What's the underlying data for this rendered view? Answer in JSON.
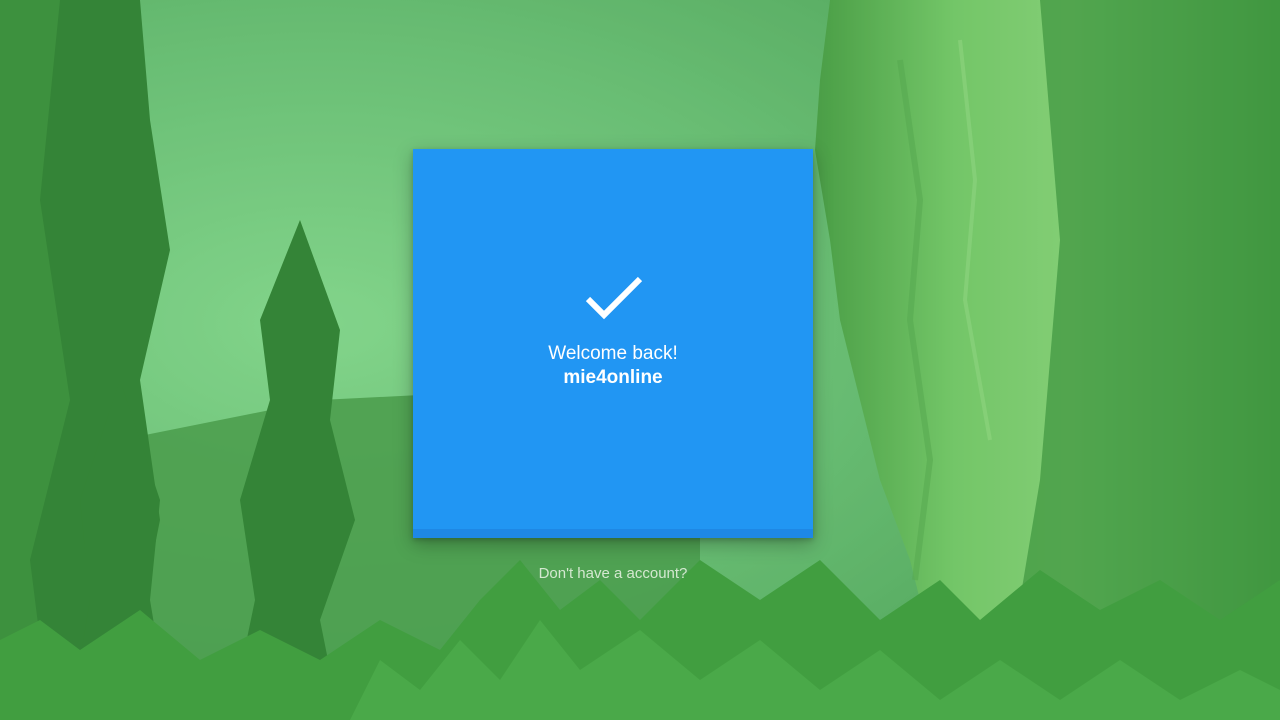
{
  "background": {
    "overlay_color": "#4caf50",
    "description_icon": "forest-cliff-background"
  },
  "card": {
    "color": "#2196f3",
    "footer_color": "#1e88e5",
    "status_icon": "checkmark-icon",
    "welcome_text": "Welcome back!",
    "username": "mie4online"
  },
  "footer": {
    "signup_link": "Don't have a account?"
  }
}
